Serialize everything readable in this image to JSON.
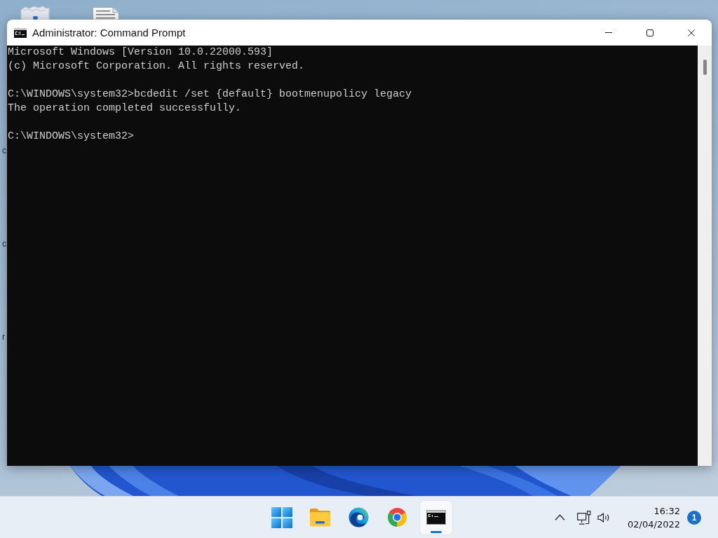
{
  "desktop": {
    "edge_label_fragments": [
      "c",
      "c",
      "r"
    ]
  },
  "window": {
    "title": "Administrator: Command Prompt",
    "console": [
      [
        "Microsoft Windows [Version 10.0.22000.593]",
        "(c) Microsoft Corporation. All rights reserved."
      ],
      [
        "C:\\WINDOWS\\system32>bcdedit /set {default} bootmenupolicy legacy",
        "The operation completed successfully."
      ],
      [
        "C:\\WINDOWS\\system32>"
      ]
    ]
  },
  "taskbar": {
    "pinned": [
      {
        "kind": "start",
        "selected": false
      },
      {
        "kind": "explorer",
        "selected": false
      },
      {
        "kind": "edge",
        "selected": false
      },
      {
        "kind": "chrome",
        "selected": false
      },
      {
        "kind": "terminal",
        "selected": true
      }
    ],
    "tray": {
      "time": "16:32",
      "date": "02/04/2022",
      "notification_count": "1"
    }
  }
}
